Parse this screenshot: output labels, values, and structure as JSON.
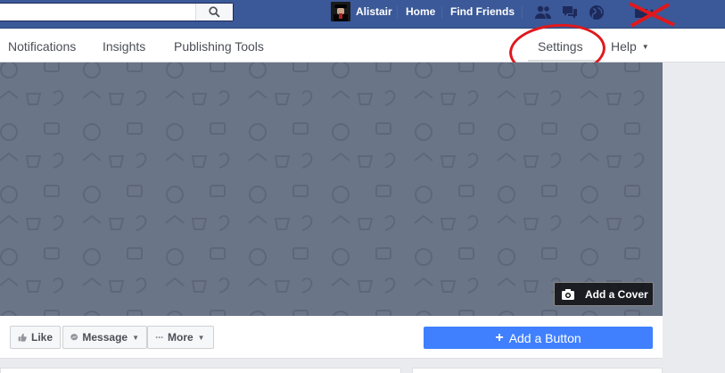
{
  "topbar": {
    "user_name": "Alistair",
    "home_label": "Home",
    "find_friends_label": "Find Friends",
    "icons": [
      "friend-requests-icon",
      "messages-icon",
      "notifications-globe-icon",
      "help-icon"
    ]
  },
  "tabs": {
    "items": [
      {
        "label": "Notifications"
      },
      {
        "label": "Insights"
      },
      {
        "label": "Publishing Tools"
      },
      {
        "label": "Settings"
      },
      {
        "label": "Help"
      }
    ]
  },
  "cover": {
    "add_cover_label": "Add a Cover"
  },
  "actions": {
    "like_label": "Like",
    "message_label": "Message",
    "more_label": "More",
    "add_button_label": "Add a Button",
    "add_button_prefix": "+"
  },
  "colors": {
    "topbar": "#3b5998",
    "primary_button": "#4080ff",
    "annotation": "#e0181c",
    "cover": "#6b7588"
  }
}
